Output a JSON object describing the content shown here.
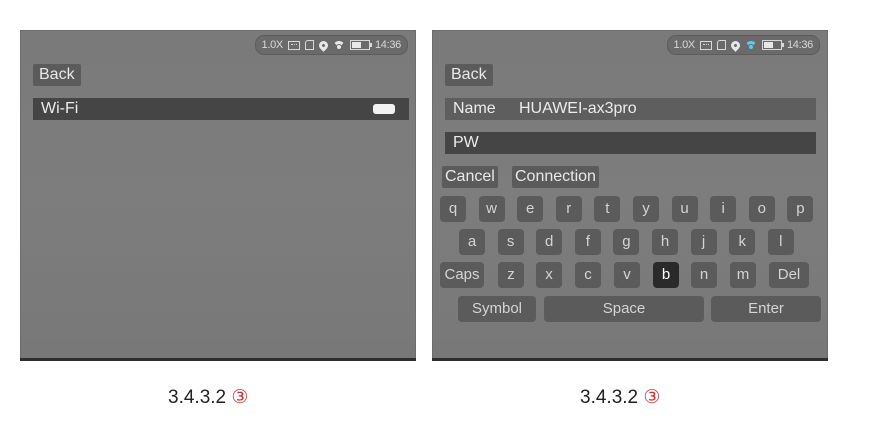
{
  "left_screen": {
    "status": {
      "zoom": "1.0X",
      "time": "14:36"
    },
    "back_label": "Back",
    "wifi": {
      "label": "Wi-Fi",
      "enabled": true
    }
  },
  "right_screen": {
    "status": {
      "zoom": "1.0X",
      "time": "14:36",
      "wifi_color": "#5ec8f0"
    },
    "back_label": "Back",
    "name": {
      "label": "Name",
      "value": "HUAWEI-ax3pro"
    },
    "password": {
      "label": "PW",
      "value": ""
    },
    "cancel_label": "Cancel",
    "connection_label": "Connection",
    "keyboard": {
      "row1": [
        "q",
        "w",
        "e",
        "r",
        "t",
        "y",
        "u",
        "i",
        "o",
        "p"
      ],
      "row2": [
        "a",
        "s",
        "d",
        "f",
        "g",
        "h",
        "j",
        "k",
        "l"
      ],
      "row3": [
        "Caps",
        "z",
        "x",
        "c",
        "v",
        "b",
        "n",
        "m",
        "Del"
      ],
      "row4": [
        "Symbol",
        "Space",
        "Enter"
      ],
      "selected_key": "b"
    }
  },
  "captions": {
    "left": {
      "text": "3.4.3.2",
      "marker": "③"
    },
    "right": {
      "text": "3.4.3.2",
      "marker": "③"
    }
  },
  "colors": {
    "marker": "#d23030",
    "selected_key": "#2a2a2a"
  }
}
